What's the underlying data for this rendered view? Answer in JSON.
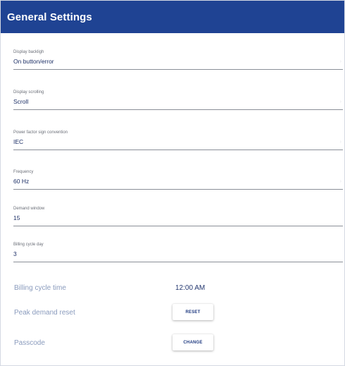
{
  "header": {
    "title": "General Settings"
  },
  "fields": [
    {
      "label": "Display backligh",
      "value": "On button/error",
      "dropdown": true
    },
    {
      "label": "Display scrolling",
      "value": "Scroll",
      "dropdown": true
    },
    {
      "label": "Power factor sign convention",
      "value": "IEC",
      "dropdown": true
    },
    {
      "label": "Frequency",
      "value": "60 Hz",
      "dropdown": true
    },
    {
      "label": "Demand window",
      "value": "15",
      "dropdown": false
    },
    {
      "label": "Billing cycle day",
      "value": "3",
      "dropdown": false
    }
  ],
  "billing_time": {
    "label": "Billing cycle time",
    "value": "12:00 AM"
  },
  "peak_reset": {
    "label": "Peak demand reset",
    "button": "RESET"
  },
  "passcode": {
    "label": "Passcode",
    "button": "CHANGE"
  },
  "colors": {
    "header_bg": "#1f4393",
    "accent": "#1f3a80"
  },
  "icons": {
    "dropdown": "chevron-down-icon"
  }
}
